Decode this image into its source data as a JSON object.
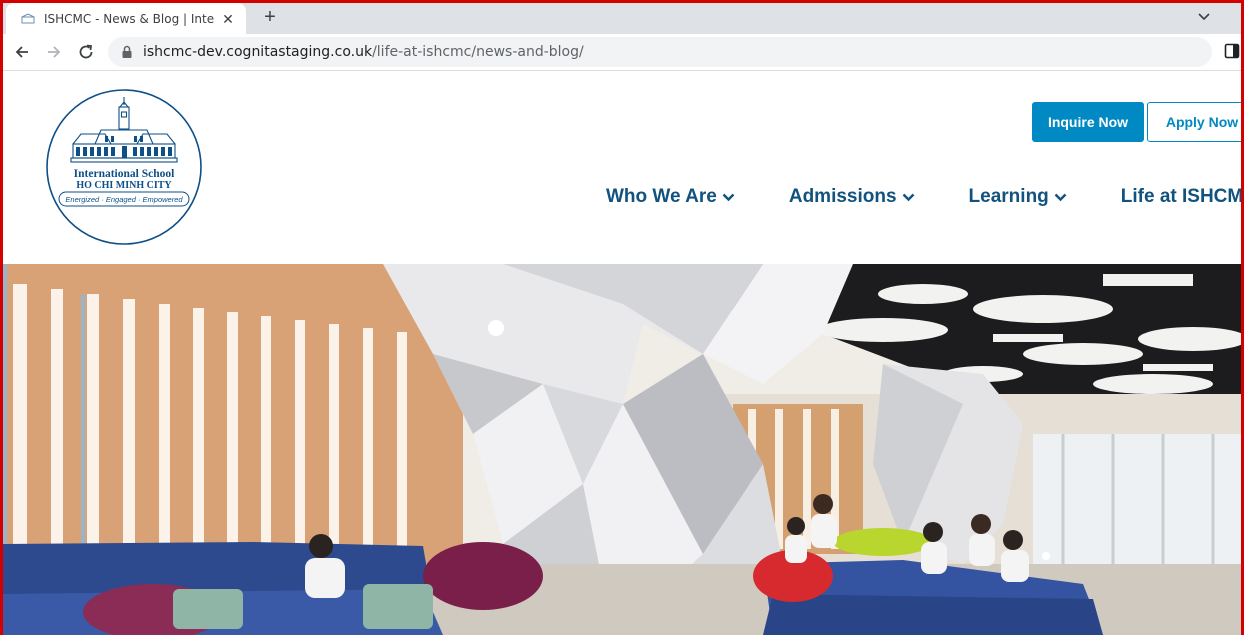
{
  "browser": {
    "tab_title": "ISHCMC - News & Blog | International School",
    "tab_close": "✕",
    "new_tab": "+",
    "url_host": "ishcmc-dev.cognitastaging.co.uk",
    "url_path": "/life-at-ishcmc/news-and-blog/"
  },
  "header": {
    "logo": {
      "line1": "International School",
      "line2": "HO CHI MINH CITY",
      "tagline": "Energized · Engaged · Empowered"
    },
    "inquire_label": "Inquire Now",
    "apply_label": "Apply Now",
    "nav": [
      {
        "label": "Who We Are"
      },
      {
        "label": "Admissions"
      },
      {
        "label": "Learning"
      },
      {
        "label": "Life at ISHCMC"
      }
    ]
  },
  "colors": {
    "brand_blue": "#0089c2",
    "nav_text": "#11527f",
    "frame_red": "#d40000"
  },
  "icons": [
    "favicon-icon",
    "close-icon",
    "plus-icon",
    "chevron-down-icon",
    "back-icon",
    "forward-icon",
    "reload-icon",
    "lock-icon",
    "side-panel-icon"
  ]
}
